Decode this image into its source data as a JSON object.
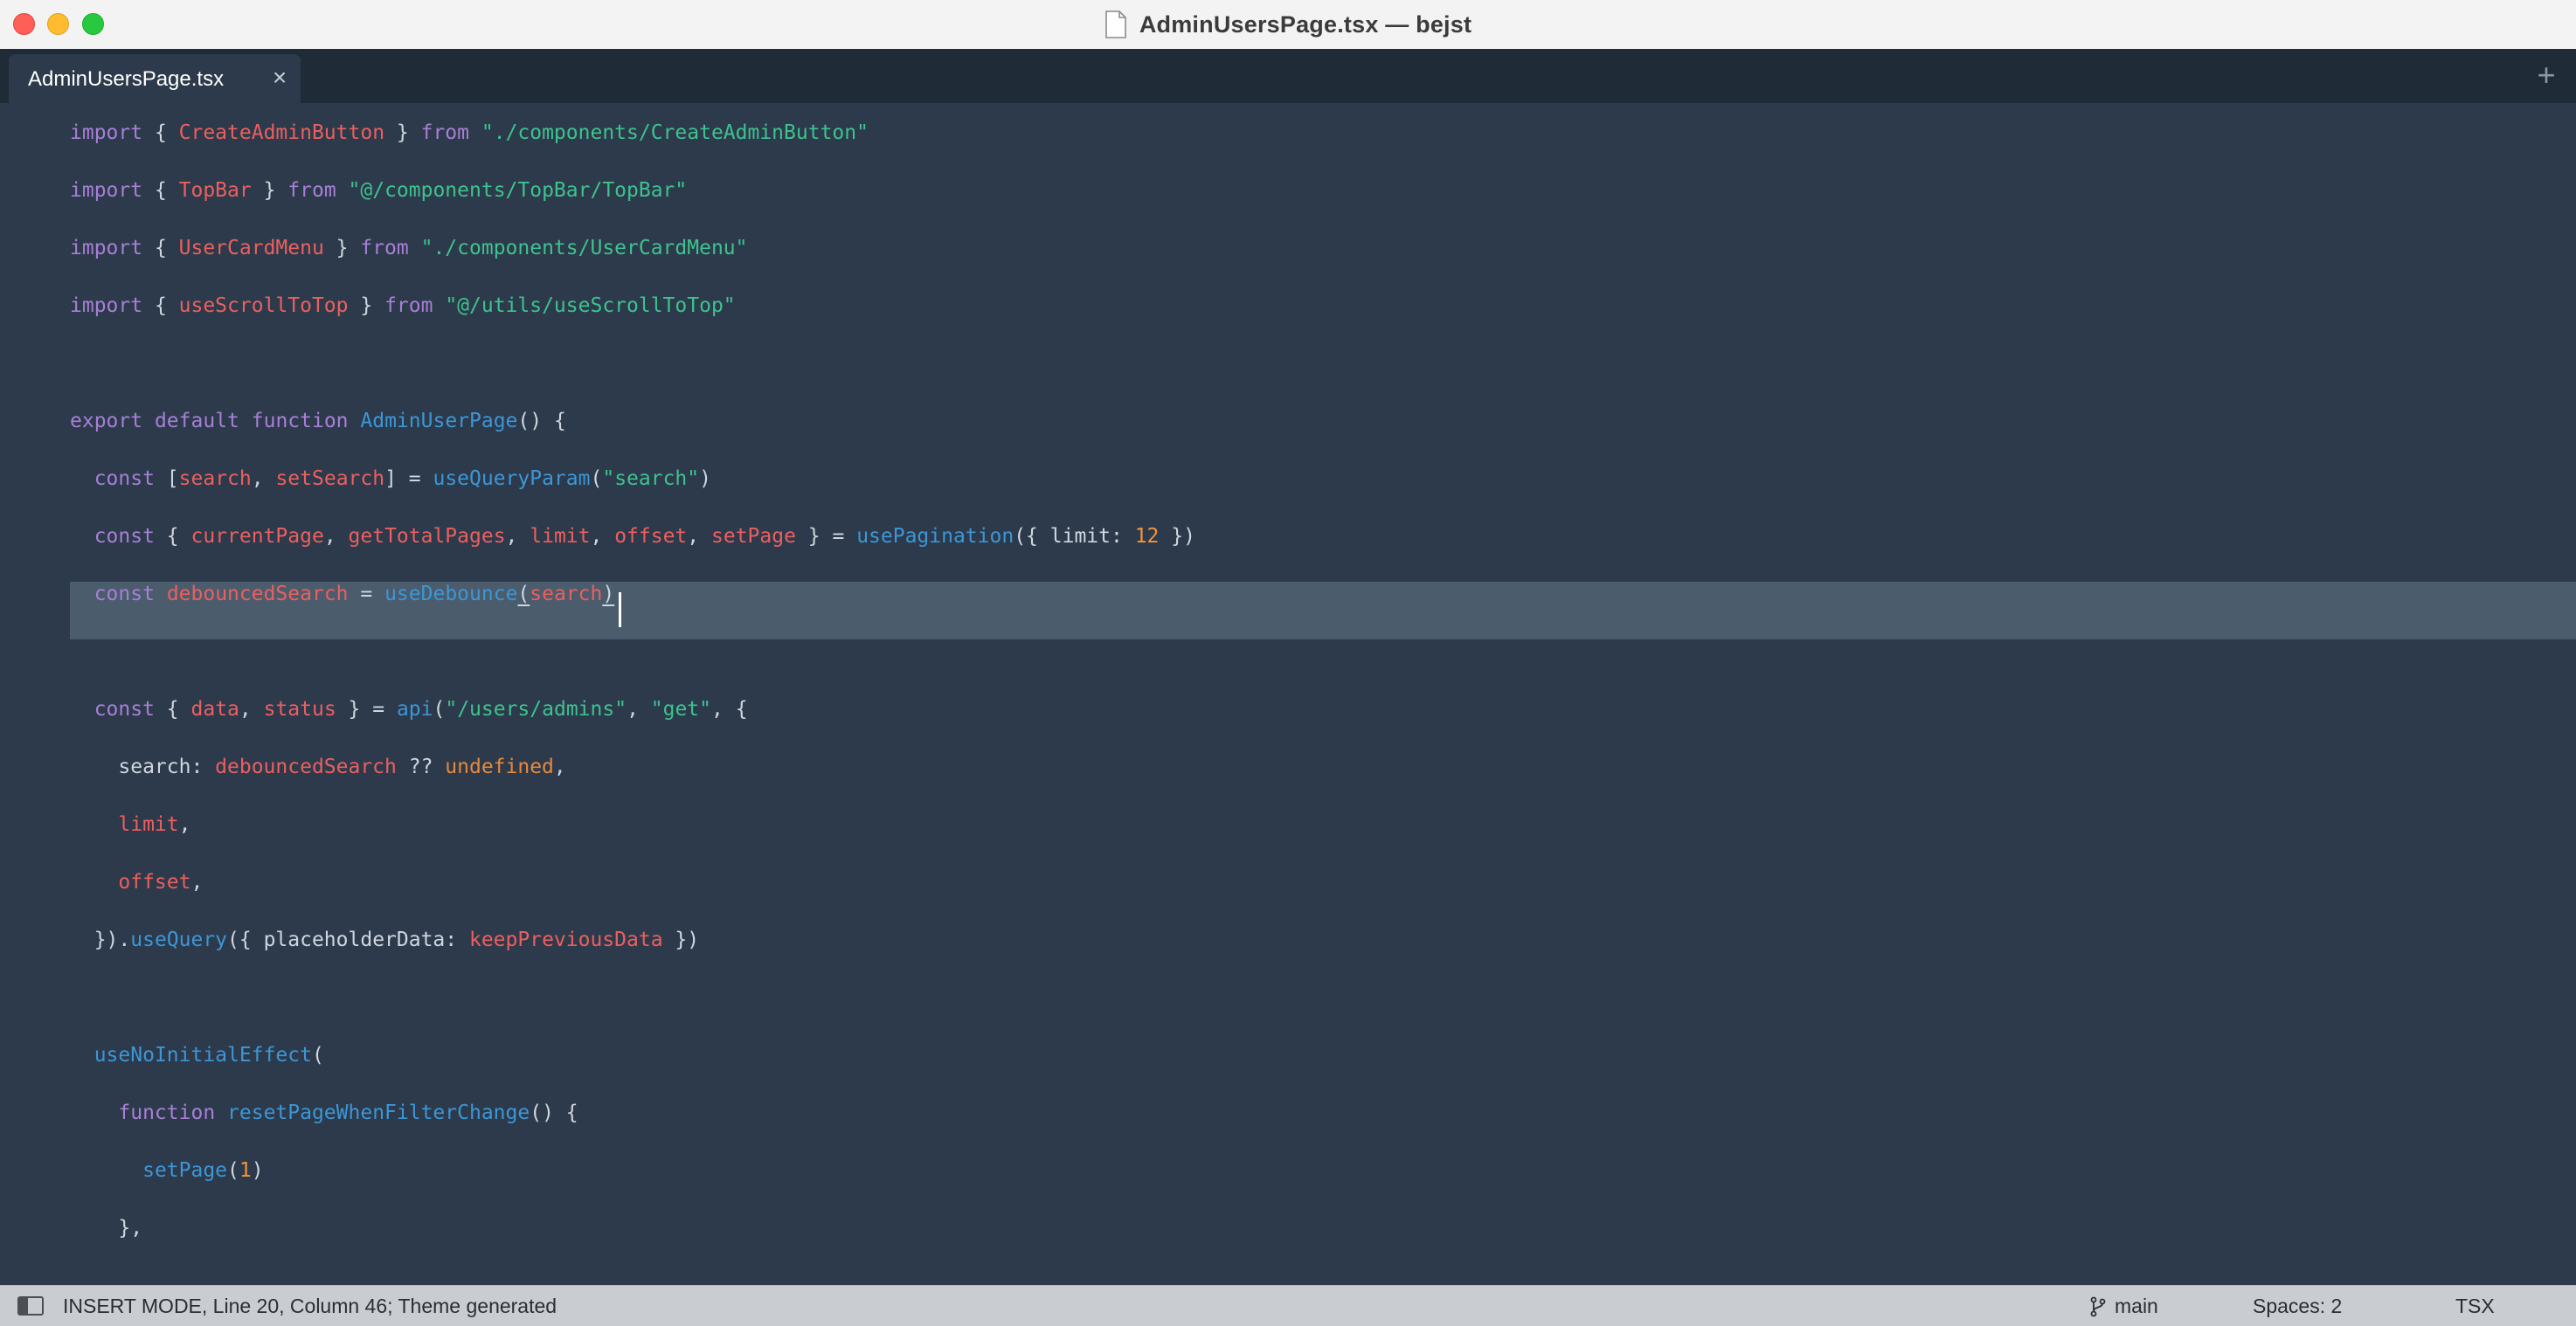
{
  "window": {
    "title": "AdminUsersPage.tsx — bejst"
  },
  "tabs": [
    {
      "label": "AdminUsersPage.tsx",
      "close_glyph": "×",
      "active": true
    }
  ],
  "tabbar": {
    "new_tab_glyph": "+"
  },
  "editor": {
    "lines": [
      [
        {
          "t": "import",
          "c": "kw"
        },
        {
          "t": " { ",
          "c": "sym"
        },
        {
          "t": "CreateAdminButton",
          "c": "id"
        },
        {
          "t": " } ",
          "c": "sym"
        },
        {
          "t": "from",
          "c": "kw"
        },
        {
          "t": " ",
          "c": "sym"
        },
        {
          "t": "\"./components/CreateAdminButton\"",
          "c": "str"
        }
      ],
      [
        {
          "t": "import",
          "c": "kw"
        },
        {
          "t": " { ",
          "c": "sym"
        },
        {
          "t": "TopBar",
          "c": "id"
        },
        {
          "t": " } ",
          "c": "sym"
        },
        {
          "t": "from",
          "c": "kw"
        },
        {
          "t": " ",
          "c": "sym"
        },
        {
          "t": "\"@/components/TopBar/TopBar\"",
          "c": "str"
        }
      ],
      [
        {
          "t": "import",
          "c": "kw"
        },
        {
          "t": " { ",
          "c": "sym"
        },
        {
          "t": "UserCardMenu",
          "c": "id"
        },
        {
          "t": " } ",
          "c": "sym"
        },
        {
          "t": "from",
          "c": "kw"
        },
        {
          "t": " ",
          "c": "sym"
        },
        {
          "t": "\"./components/UserCardMenu\"",
          "c": "str"
        }
      ],
      [
        {
          "t": "import",
          "c": "kw"
        },
        {
          "t": " { ",
          "c": "sym"
        },
        {
          "t": "useScrollToTop",
          "c": "id"
        },
        {
          "t": " } ",
          "c": "sym"
        },
        {
          "t": "from",
          "c": "kw"
        },
        {
          "t": " ",
          "c": "sym"
        },
        {
          "t": "\"@/utils/useScrollToTop\"",
          "c": "str"
        }
      ],
      [],
      [
        {
          "t": "export",
          "c": "kw"
        },
        {
          "t": " ",
          "c": "sym"
        },
        {
          "t": "default",
          "c": "kw"
        },
        {
          "t": " ",
          "c": "sym"
        },
        {
          "t": "function",
          "c": "kw"
        },
        {
          "t": " ",
          "c": "sym"
        },
        {
          "t": "AdminUserPage",
          "c": "fn"
        },
        {
          "t": "() {",
          "c": "sym"
        }
      ],
      [
        {
          "t": "  ",
          "c": "sym"
        },
        {
          "t": "const",
          "c": "kw"
        },
        {
          "t": " [",
          "c": "sym"
        },
        {
          "t": "search",
          "c": "id"
        },
        {
          "t": ", ",
          "c": "sym"
        },
        {
          "t": "setSearch",
          "c": "id"
        },
        {
          "t": "] = ",
          "c": "sym"
        },
        {
          "t": "useQueryParam",
          "c": "fn"
        },
        {
          "t": "(",
          "c": "sym"
        },
        {
          "t": "\"search\"",
          "c": "str"
        },
        {
          "t": ")",
          "c": "sym"
        }
      ],
      [
        {
          "t": "  ",
          "c": "sym"
        },
        {
          "t": "const",
          "c": "kw"
        },
        {
          "t": " { ",
          "c": "sym"
        },
        {
          "t": "currentPage",
          "c": "id"
        },
        {
          "t": ", ",
          "c": "sym"
        },
        {
          "t": "getTotalPages",
          "c": "id"
        },
        {
          "t": ", ",
          "c": "sym"
        },
        {
          "t": "limit",
          "c": "id"
        },
        {
          "t": ", ",
          "c": "sym"
        },
        {
          "t": "offset",
          "c": "id"
        },
        {
          "t": ", ",
          "c": "sym"
        },
        {
          "t": "setPage",
          "c": "id"
        },
        {
          "t": " } = ",
          "c": "sym"
        },
        {
          "t": "usePagination",
          "c": "fn"
        },
        {
          "t": "({ limit: ",
          "c": "sym"
        },
        {
          "t": "12",
          "c": "num"
        },
        {
          "t": " })",
          "c": "sym"
        }
      ],
      [
        {
          "t": "  ",
          "c": "sym"
        },
        {
          "t": "const",
          "c": "kw"
        },
        {
          "t": " ",
          "c": "sym"
        },
        {
          "t": "debouncedSearch",
          "c": "id"
        },
        {
          "t": " = ",
          "c": "sym"
        },
        {
          "t": "useDebounce",
          "c": "fn"
        },
        {
          "t": "(",
          "c": "bm"
        },
        {
          "t": "search",
          "c": "id"
        },
        {
          "t": ")",
          "c": "bm"
        }
      ],
      [],
      [
        {
          "t": "  ",
          "c": "sym"
        },
        {
          "t": "const",
          "c": "kw"
        },
        {
          "t": " { ",
          "c": "sym"
        },
        {
          "t": "data",
          "c": "id"
        },
        {
          "t": ", ",
          "c": "sym"
        },
        {
          "t": "status",
          "c": "id"
        },
        {
          "t": " } = ",
          "c": "sym"
        },
        {
          "t": "api",
          "c": "fn"
        },
        {
          "t": "(",
          "c": "sym"
        },
        {
          "t": "\"/users/admins\"",
          "c": "str"
        },
        {
          "t": ", ",
          "c": "sym"
        },
        {
          "t": "\"get\"",
          "c": "str"
        },
        {
          "t": ", {",
          "c": "sym"
        }
      ],
      [
        {
          "t": "    search: ",
          "c": "pl"
        },
        {
          "t": "debouncedSearch",
          "c": "id"
        },
        {
          "t": " ?? ",
          "c": "sym"
        },
        {
          "t": "undefined",
          "c": "un"
        },
        {
          "t": ",",
          "c": "sym"
        }
      ],
      [
        {
          "t": "    ",
          "c": "sym"
        },
        {
          "t": "limit",
          "c": "id"
        },
        {
          "t": ",",
          "c": "sym"
        }
      ],
      [
        {
          "t": "    ",
          "c": "sym"
        },
        {
          "t": "offset",
          "c": "id"
        },
        {
          "t": ",",
          "c": "sym"
        }
      ],
      [
        {
          "t": "  }).",
          "c": "sym"
        },
        {
          "t": "useQuery",
          "c": "fn"
        },
        {
          "t": "({ placeholderData: ",
          "c": "pl"
        },
        {
          "t": "keepPreviousData",
          "c": "id"
        },
        {
          "t": " })",
          "c": "sym"
        }
      ],
      [],
      [
        {
          "t": "  ",
          "c": "sym"
        },
        {
          "t": "useNoInitialEffect",
          "c": "fn"
        },
        {
          "t": "(",
          "c": "sym"
        }
      ],
      [
        {
          "t": "    ",
          "c": "sym"
        },
        {
          "t": "function",
          "c": "kw"
        },
        {
          "t": " ",
          "c": "sym"
        },
        {
          "t": "resetPageWhenFilterChange",
          "c": "fn"
        },
        {
          "t": "() {",
          "c": "sym"
        }
      ],
      [
        {
          "t": "      ",
          "c": "sym"
        },
        {
          "t": "setPage",
          "c": "fn"
        },
        {
          "t": "(",
          "c": "sym"
        },
        {
          "t": "1",
          "c": "num"
        },
        {
          "t": ")",
          "c": "sym"
        }
      ],
      [
        {
          "t": "    },",
          "c": "sym"
        }
      ]
    ]
  },
  "statusbar": {
    "mode_text": "INSERT MODE, Line 20, Column 46; Theme generated",
    "branch": "main",
    "spaces": "Spaces: 2",
    "language": "TSX"
  }
}
